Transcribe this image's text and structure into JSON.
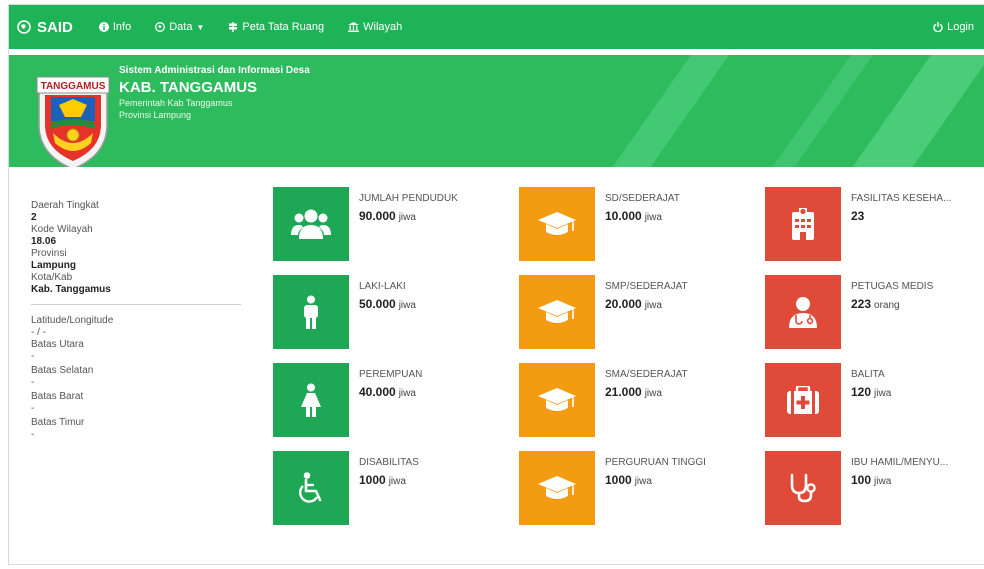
{
  "navbar": {
    "brand": "SAID",
    "items": [
      {
        "label": "Info",
        "icon": "info-circle-icon"
      },
      {
        "label": "Data",
        "icon": "globe-icon",
        "caret": "▼"
      },
      {
        "label": "Peta Tata Ruang",
        "icon": "signpost-icon"
      },
      {
        "label": "Wilayah",
        "icon": "institution-icon"
      }
    ],
    "login": "Login",
    "color": "#1fb357"
  },
  "banner": {
    "logo_text": "TANGGAMUS",
    "system_name": "Sistem Administrasi dan Informasi Desa",
    "title": "KAB. TANGGAMUS",
    "line1": "Pemerintah Kab Tanggamus",
    "line2": "Provinsi Lampung"
  },
  "sidebar": {
    "daerah_tingkat_label": "Daerah Tingkat",
    "daerah_tingkat": "2",
    "kode_wilayah_label": "Kode Wilayah",
    "kode_wilayah": "18.06",
    "provinsi_label": "Provinsi",
    "provinsi": "Lampung",
    "kota_label": "Kota/Kab",
    "kota": "Kab. Tanggamus",
    "latlong_label": "Latitude/Longitude",
    "latlong": "- / -",
    "utara_label": "Batas Utara",
    "utara": "-",
    "selatan_label": "Batas Selatan",
    "selatan": "-",
    "barat_label": "Batas Barat",
    "barat": "-",
    "timur_label": "Batas Timur",
    "timur": "-"
  },
  "cards": {
    "penduduk": {
      "title": "JUMLAH PENDUDUK",
      "value": "90.000",
      "unit": "jiwa"
    },
    "laki": {
      "title": "LAKI-LAKI",
      "value": "50.000",
      "unit": "jiwa"
    },
    "perempuan": {
      "title": "PEREMPUAN",
      "value": "40.000",
      "unit": "jiwa"
    },
    "disabilitas": {
      "title": "DISABILITAS",
      "value": "1000",
      "unit": "jiwa"
    },
    "sd": {
      "title": "SD/SEDERAJAT",
      "value": "10.000",
      "unit": "jiwa"
    },
    "smp": {
      "title": "SMP/SEDERAJAT",
      "value": "20.000",
      "unit": "jiwa"
    },
    "sma": {
      "title": "SMA/SEDERAJAT",
      "value": "21.000",
      "unit": "jiwa"
    },
    "pt": {
      "title": "PERGURUAN TINGGI",
      "value": "1000",
      "unit": "jiwa"
    },
    "faskes": {
      "title": "FASILITAS KESEHA...",
      "value": "23",
      "unit": ""
    },
    "medis": {
      "title": "PETUGAS MEDIS",
      "value": "223",
      "unit": "orang"
    },
    "balita": {
      "title": "BALITA",
      "value": "120",
      "unit": "jiwa"
    },
    "ibu": {
      "title": "IBU HAMIL/MENYU...",
      "value": "100",
      "unit": "jiwa"
    }
  },
  "colors": {
    "green": "#1ea855",
    "orange": "#f39c12",
    "red": "#df4b38"
  }
}
